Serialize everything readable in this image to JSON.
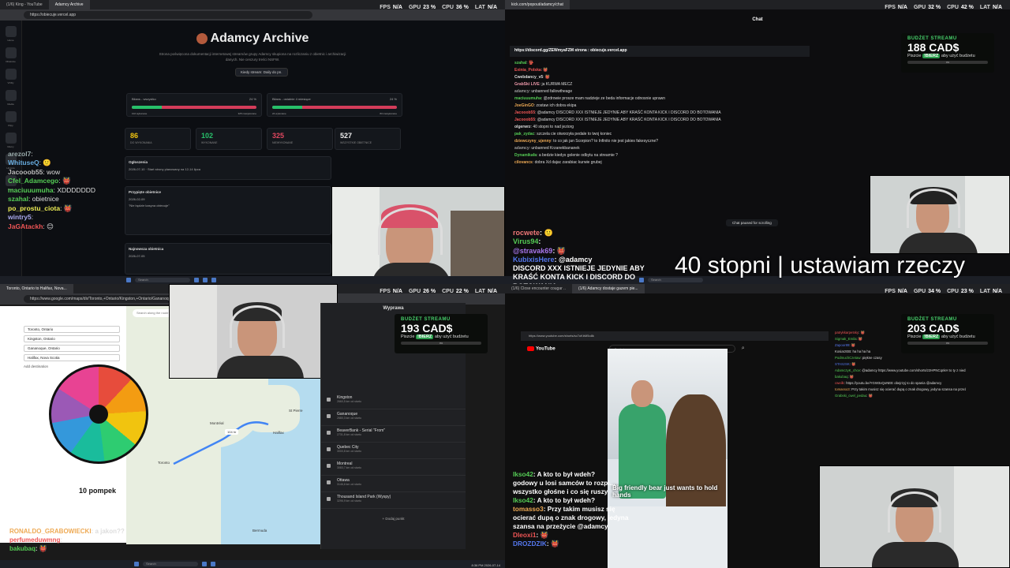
{
  "q1": {
    "tabs": [
      "(1/6) King - YouTube",
      "Adamcy Archive"
    ],
    "url": "https://obiecuje.vercel.app",
    "hud": {
      "fps": "N/A",
      "gpu": "23 %",
      "cpu": "36 %",
      "lat": "N/A"
    },
    "sidebar": [
      "Home",
      "Obietnice",
      "VODy",
      "Media",
      "Klipy",
      "Memy",
      "Historia",
      "Mapa"
    ],
    "title": "Adamcy Archive",
    "desc": "Strona poświęcona dokumentacji internetowej streamów grupy Adamcy skupiona na rozliczaniu z obietnic i archiwizacji danych. Nie cenzury treści NSFW.",
    "stream_pill": "Kiedy stream: Daily do pn.",
    "bars": [
      {
        "label": "Bilans - wszystko",
        "pct": "24 %",
        "fill": 0.24,
        "sub_l": "102 wykonane",
        "sub_r": "325 niewykonane"
      },
      {
        "label": "Bilans - ostatnie 4 miesiące",
        "pct": "24 %",
        "fill": 0.24,
        "sub_l": "24 wykonane",
        "sub_r": "83 niewykonane"
      }
    ],
    "stats": [
      {
        "n": "86",
        "l": "Do wykonania",
        "color": "#f1c40f"
      },
      {
        "n": "102",
        "l": "Wykonane",
        "color": "#27c06a"
      },
      {
        "n": "325",
        "l": "Niewykonane",
        "color": "#e0475f"
      },
      {
        "n": "527",
        "l": "Wszystkie obietnice",
        "color": "#eeeeee"
      }
    ],
    "announce_h": "Ogłoszenia",
    "announce": "2026-07-10 · Start strony planowany na 12-14 lipca",
    "promises_h": "Przypięte obietnice",
    "promise_date": "2026-02-09",
    "promise_text": "\"Nie będzie kasyna obiecuje\"",
    "newest_h": "Najnowsza obietnica",
    "newest_date": "2026-07-05",
    "chat": [
      {
        "u": "arezol7",
        "t": ": ",
        "c": "#9aa"
      },
      {
        "u": "WhituseQ",
        "t": ": 🙂",
        "c": "#6ad"
      },
      {
        "u": "Jacooob55",
        "t": ": wow",
        "c": "#bbb"
      },
      {
        "u": "Cfel_Adamcego",
        "t": ": 👹",
        "c": "#5c5"
      },
      {
        "u": "maciuuumuha",
        "t": ": XDDDDDDD",
        "c": "#5c5"
      },
      {
        "u": "szahal",
        "t": ": obietnice",
        "c": "#5c5"
      },
      {
        "u": "po_prostu_ciota",
        "t": ": 👹",
        "c": "#ee5"
      },
      {
        "u": "wintry5",
        "t": ": ",
        "c": "#aae"
      },
      {
        "u": "JaGAtackh",
        "t": ": 😊",
        "c": "#e55"
      }
    ]
  },
  "q2": {
    "url": "kick.com/popout/adamcy/chat",
    "header": "Chat",
    "hud": {
      "fps": "N/A",
      "gpu": "32 %",
      "cpu": "42 %",
      "lat": "N/A"
    },
    "pinned_link": "https://discord.gg/ZEWmyaFZM strona : obiecuje.vercel.app",
    "messages": [
      {
        "u": "szahal",
        "t": ": 👺",
        "c": "#5c5"
      },
      {
        "u": "Exinia_Polska",
        "t": ": 👹",
        "c": "#e55"
      },
      {
        "u": "Cwebdancy_v5",
        "t": ": 👹",
        "c": "#ddd"
      },
      {
        "u": "GrabSki LIVE",
        "t": ": ja KURWA MECZ",
        "c": "#e9a"
      },
      {
        "u": "adamcy",
        "t": ": unbanned fallowtheage",
        "c": "#999"
      },
      {
        "u": "maciuuumuha",
        "t": ": @zdrowie prosze mam nadzieje ze beda informacje odnosnie uprawn",
        "c": "#5c5"
      },
      {
        "u": "JoeGinGO",
        "t": ": zostaw ich dobra ekipa",
        "c": "#ea5"
      },
      {
        "u": "Jacooob55",
        "t": ": @adamcy DISCORD XXX ISTNIEJE JEDYNIE ABY KRAŚĆ KONTA KICK I DISCORD DO BOTOWANIA",
        "c": "#e55"
      },
      {
        "u": "Jacooob55",
        "t": ": @adamcy DISCORD XXX ISTNIEJE JEDYNIE ABY KRAŚĆ KONTA KICK I DISCORD DO BOTOWANIA",
        "c": "#e55"
      },
      {
        "u": "olgerwrz",
        "t": ": 40 stopni to nad jeziorg",
        "c": "#ddd"
      },
      {
        "u": "pak_zydac",
        "t": ": szczela cie otworzyła pedale to twoj koniec",
        "c": "#5c5"
      },
      {
        "u": "dziewczyny_ujenny",
        "t": ": to co jak jan Scorpion? to Infinito nie jest jakies fakesyczne?",
        "c": "#ea5"
      },
      {
        "u": "adamcy",
        "t": ": unbanned Krzanekbananek",
        "c": "#999"
      },
      {
        "u": "Dynamikafa",
        "t": ": a bedzie kiedys golenie odbytu na streamie ?",
        "c": "#5c5"
      },
      {
        "u": "cilovancs",
        "t": ": dobra Xd dajac zarabiac kurwie grubej",
        "c": "#ea5"
      }
    ],
    "chat_paused": "Chat paused for scrolling",
    "big_chat": [
      {
        "u": "rocwete",
        "t": ": 🙂",
        "c": "#e77"
      },
      {
        "u": "Virus94",
        "t": ": ",
        "c": "#5c5"
      },
      {
        "u": "@stravak69",
        "t": ": 👹",
        "c": "#a7e"
      },
      {
        "u": "KubixisHere",
        "t": ": @adamcy",
        "c": "#57e"
      },
      {
        "u": "",
        "t": "DISCORD XXX ISTNIEJE JEDYNIE ABY KRAŚĆ KONTA KICK I DISCORD DO BOTOWANIA",
        "c": "#fff"
      },
      {
        "u": "skapsior",
        "t": ": rup cos 🤝",
        "c": "#5c5"
      }
    ],
    "overlay_text": "40 stopni | ustawiam rzeczy",
    "budget": {
      "h": "BUDŻET STREAMU",
      "v": "188 CAD$",
      "pre": "Piszcie",
      "kw": "!BIERZ",
      "post": "aby użyć budżetu",
      "pct": "0%"
    }
  },
  "q3": {
    "tabs": [
      "Toronto, Ontario to Halifax, Nova..."
    ],
    "url": "https://www.google.com/maps/dir/Toronto,+Ontario/Kingston,+Ontario/Gananoque",
    "hud": {
      "fps": "N/A",
      "gpu": "26 %",
      "cpu": "22 %",
      "lat": "N/A"
    },
    "route_stops": [
      "Toronto, Ontario",
      "Kingston, Ontario",
      "Gananoque, Ontario",
      "Halifax, Nova Scotia"
    ],
    "add_dest": "Add destination",
    "search_placeholder": "Search along the route",
    "distance": "104 hr",
    "map_labels": {
      "toronto": "Toronto",
      "montreal": "Montréal",
      "halifax": "Halifax",
      "bermuda": "Bermuda",
      "stpierre": "St Pierre"
    },
    "wheel_label": "10 pompek",
    "chat": [
      {
        "u": "RONALDO_GRABOWIECKI",
        "t": ": a jakon??",
        "c": "#ea5"
      },
      {
        "u": "perfumeduwmng",
        "t": ": ",
        "c": "#e55"
      },
      {
        "u": "bakubaq",
        "t": ": 👹",
        "c": "#5c5"
      }
    ],
    "panel_title": "Wyprawa",
    "stops": [
      {
        "n": "Kingston",
        "d": "2660,5 km od startu"
      },
      {
        "n": "Gananoque",
        "d": "2680,3 km od startu"
      },
      {
        "n": "BeaverBank - Serial \"From\"",
        "d": "2731,8 km od startu"
      },
      {
        "n": "Quebec City",
        "d": "3000,8 km od startu"
      },
      {
        "n": "Montreal",
        "d": "3083,7 km od startu"
      },
      {
        "n": "Ottawa",
        "d": "3146,6 km od startu"
      },
      {
        "n": "Thousand Island Park (Wyspy)",
        "d": "3296,9 km od startu"
      }
    ],
    "add_point": "+ Dodaj punkt",
    "budget": {
      "h": "BUDŻET STREAMU",
      "v": "193 CAD$",
      "pre": "Piszcie",
      "kw": "!BIERZ",
      "post": "aby użyć budżetu",
      "pct": "0%"
    },
    "time": "8:36 PM 2026-07-14"
  },
  "q4": {
    "tabs": [
      "(1/6) Close encounter cougar ..",
      "(1/6) Adamcy dostaje gazem pie..."
    ],
    "url": "https://www.youtube.com/shorts/sc7oKbM5o8k",
    "hud": {
      "fps": "N/A",
      "gpu": "34 %",
      "cpu": "23 %",
      "lat": "N/A"
    },
    "yt_logo": "YouTube",
    "yt_search": "Szukaj",
    "video_caption": "Big friendly bear just wants to hold hands",
    "chat_small": [
      {
        "u": "patrykkarpetsky",
        "t": ": 👹",
        "c": "#e55"
      },
      {
        "u": "Sigmak_Emila",
        "t": ": 👹",
        "c": "#5c5"
      },
      {
        "u": "Zapoor89",
        "t": ": 👹",
        "c": "#57e"
      },
      {
        "u": "KosiarzEB",
        "t": ": ha ha ha ha",
        "c": "#ddd"
      },
      {
        "u": "PodmuchCzetaw",
        "t": ": piękne czasy",
        "c": "#5c5"
      },
      {
        "u": "STASzSK",
        "t": ": 👹",
        "c": "#57e"
      },
      {
        "u": "AdamczyK_chce",
        "t": ": @adamcy https://www.youtube.com/shorts/z2HPNCqnkH to ty z niedzwiedziem",
        "c": "#5c5"
      },
      {
        "u": "bakubaq",
        "t": ": 👹",
        "c": "#5c5"
      },
      {
        "u": "cweilk",
        "t": ": https://youtu.be/YGW3xQoNEE obejrzyj to do spania @adamcy",
        "c": "#e55"
      },
      {
        "u": "tomasso3",
        "t": ": Przy takim musisz się ocierać dupą o znak drogowy, jedyna szansa na przeżycie @adamcy",
        "c": "#ea5"
      },
      {
        "u": "Grabski_cwel_pedau",
        "t": ": 👹",
        "c": "#5c5"
      }
    ],
    "budget": {
      "h": "BUDŻET STREAMU",
      "v": "203 CAD$",
      "pre": "Piszcie",
      "kw": "!BIERZ",
      "post": "aby użyć budżetu",
      "pct": "0%"
    },
    "kick_chat": [
      {
        "u": "lkso42",
        "t": ": A kto to był wdeh?",
        "c": "#5c5"
      },
      {
        "u": "",
        "t": "godowy u losi samców to rozpi...",
        "c": "#fff"
      },
      {
        "u": "",
        "t": "wszystko głośne i co się ruszy",
        "c": "#fff"
      },
      {
        "u": "lkso42",
        "t": ": A kto to był wdeh?",
        "c": "#5c5"
      },
      {
        "u": "tomasso3",
        "t": ": Przy takim musisz się ocierać dupą o znak drogowy, jedyna szansa na przeżycie @adamcy",
        "c": "#ea5"
      },
      {
        "u": "Dleoxi1",
        "t": ": 👹",
        "c": "#e55"
      },
      {
        "u": "DROZDZIK",
        "t": ": 👹",
        "c": "#57e"
      }
    ]
  }
}
